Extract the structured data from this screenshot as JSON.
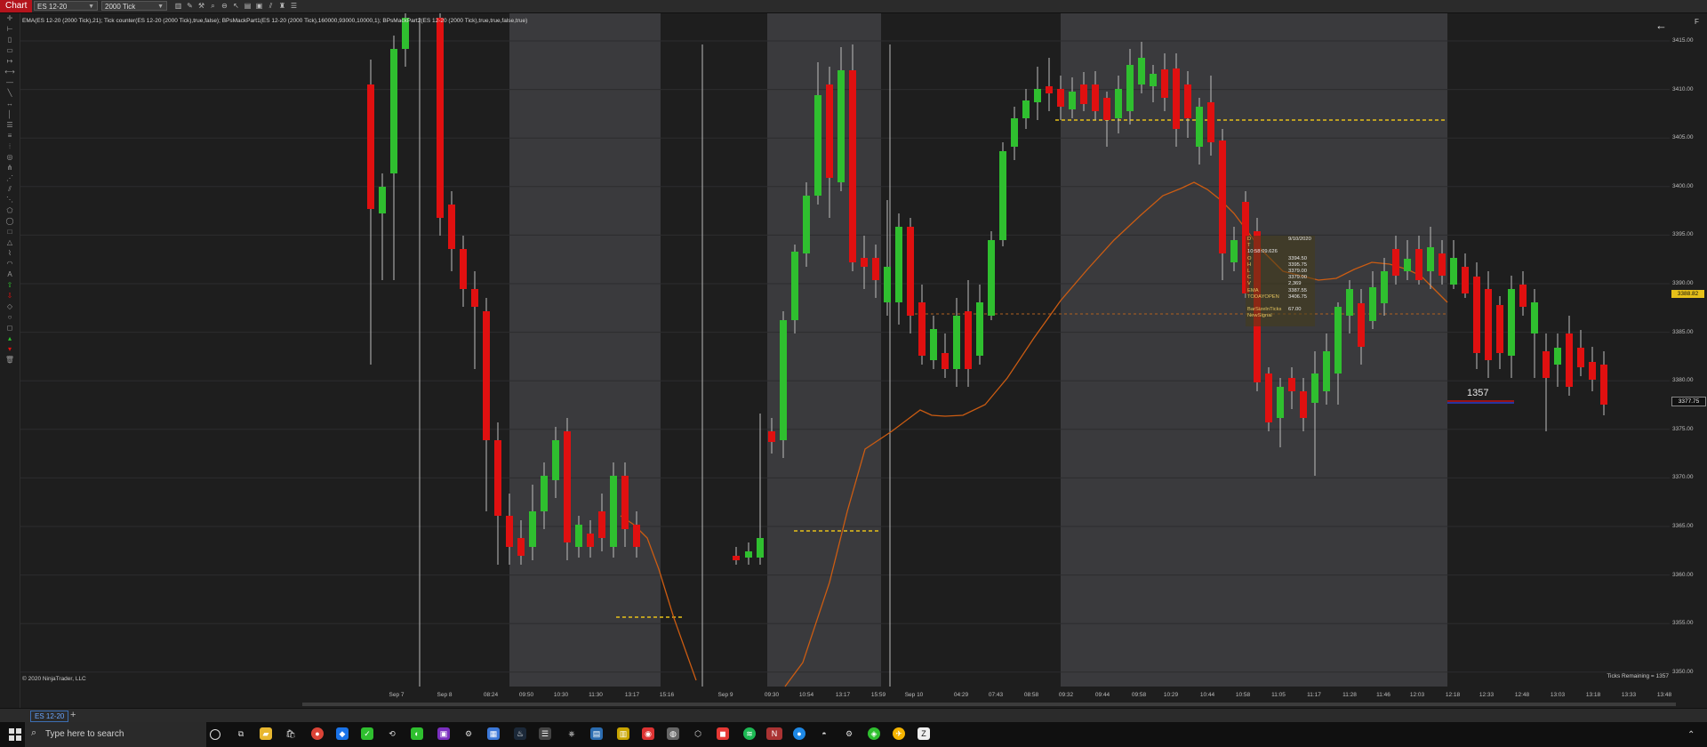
{
  "toolbar": {
    "chart_tab": "Chart",
    "instrument": "ES 12-20",
    "interval": "2000 Tick"
  },
  "indicator_label": "EMA(ES 12-20 (2000 Tick),21); Tick counter(ES 12-20 (2000 Tick),true,false); BPsMackPart1(ES 12-20 (2000 Tick),160000,93000,10000,1); BPsMackPart2(ES 12-20 (2000 Tick),true,true,false,true)",
  "copyright": "© 2020 NinjaTrader, LLC",
  "ticks_remaining": "Ticks Remaining = 1357",
  "bar_counter": "1357",
  "f_letter": "F",
  "price_axis": {
    "labels": [
      "3415.00",
      "3410.00",
      "3405.00",
      "3400.00",
      "3395.00",
      "3390.00",
      "3385.00",
      "3380.00",
      "3375.00",
      "3370.00",
      "3365.00",
      "3360.00",
      "3355.00",
      "3350.00"
    ],
    "ema_marker": "3388.82",
    "last_price": "3377.75"
  },
  "time_axis": [
    "Sep 7",
    "Sep 8",
    "08:24",
    "09:50",
    "10:30",
    "11:30",
    "13:17",
    "15:16",
    "Sep 9",
    "09:30",
    "10:54",
    "13:17",
    "15:59",
    "Sep 10",
    "04:29",
    "07:43",
    "08:58",
    "09:32",
    "09:44",
    "09:58",
    "10:29",
    "10:44",
    "10:58",
    "11:05",
    "11:17",
    "11:28",
    "11:46",
    "12:03",
    "12:18",
    "12:33",
    "12:48",
    "13:03",
    "13:18",
    "13:33",
    "13:48"
  ],
  "tooltip": {
    "rows": [
      {
        "k": "D",
        "v": "9/10/2020"
      },
      {
        "k": "T",
        "v": "10:58:09.626"
      },
      {
        "k": "O",
        "v": "3394.50"
      },
      {
        "k": "H",
        "v": "3395.75"
      },
      {
        "k": "L",
        "v": "3379.00"
      },
      {
        "k": "C",
        "v": "3379.00"
      },
      {
        "k": "V",
        "v": "2,369"
      },
      {
        "k": "EMA",
        "v": "3387.55"
      },
      {
        "k": "TODAYOPEN",
        "v": "3406.75"
      },
      {
        "k": "",
        "v": ""
      },
      {
        "k": "BarSizeInTicks",
        "v": "67.00"
      },
      {
        "k": "NewSignal",
        "v": ""
      }
    ]
  },
  "bottom_tab": "ES 12-20",
  "taskbar": {
    "search_placeholder": "Type here to search"
  },
  "colors": {
    "up_candle": "#2fbf2f",
    "down_candle": "#e01010",
    "ema_line": "#cc5c12",
    "level_line": "#e6c019",
    "session_shade": "#3a3a3d",
    "background": "#1e1e1e"
  }
}
